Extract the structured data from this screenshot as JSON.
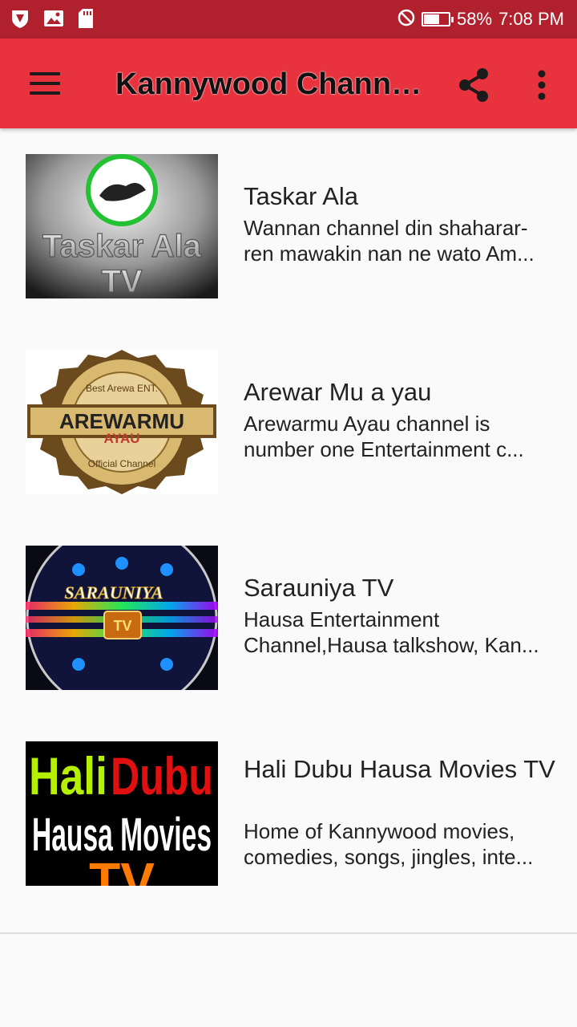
{
  "status_bar": {
    "battery": "58%",
    "time": "7:08 PM",
    "icons": [
      "shield-app-icon",
      "image-icon",
      "sd-card-icon",
      "do-not-disturb-icon",
      "battery-icon"
    ]
  },
  "app_bar": {
    "title": "Kannywood Channe...",
    "icons": [
      "menu-icon",
      "share-icon",
      "more-vert-icon"
    ]
  },
  "colors": {
    "status_bar": "#b0202d",
    "app_bar": "#e8323e",
    "background": "#fafafa"
  },
  "channels": [
    {
      "title": "Taskar Ala",
      "description": "Wannan channel din shaharar-ren mawakin nan ne wato Am...",
      "thumb_text": [
        "Taskar Ala",
        "TV"
      ]
    },
    {
      "title": "Arewar Mu a yau",
      "description": "Arewarmu Ayau channel is number one Entertainment c...",
      "thumb_text": [
        "AREWARMU",
        "AYAU",
        "Best Arewa ENT.",
        "Official Channel"
      ]
    },
    {
      "title": "Sarauniya TV",
      "description": "Hausa Entertainment Channel,Hausa talkshow, Kan...",
      "thumb_text": [
        "SARAUNIYA",
        "TV"
      ]
    },
    {
      "title": "Hali Dubu Hausa Movies TV",
      "description": "Home of Kannywood movies, comedies, songs, jingles, inte...",
      "thumb_text": [
        "Hali",
        "Dubu",
        "Hausa Movies",
        "TV"
      ]
    }
  ]
}
